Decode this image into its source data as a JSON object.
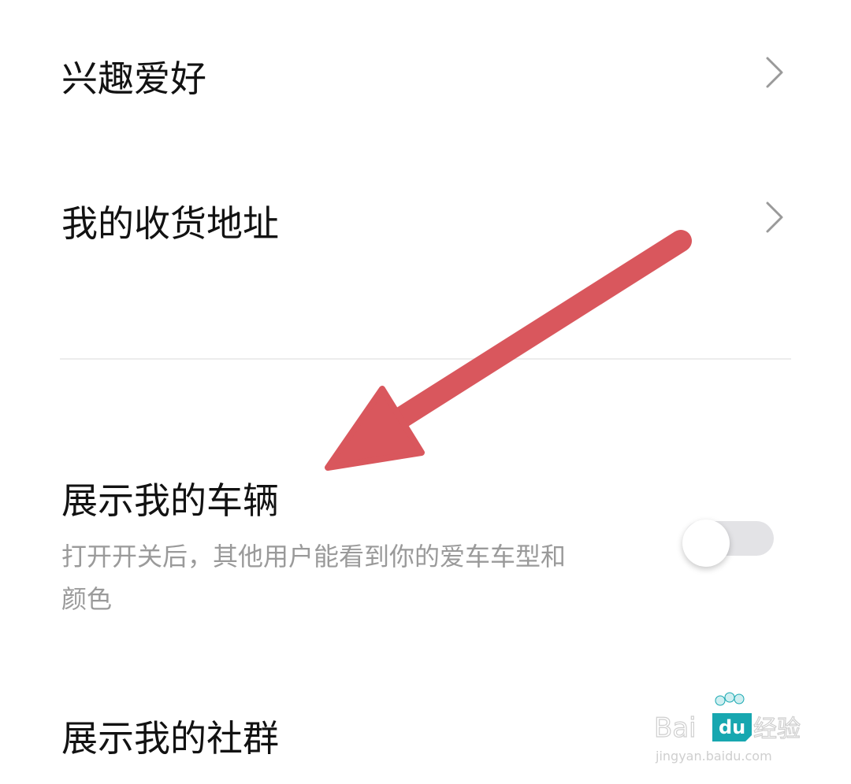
{
  "settings": {
    "items": [
      {
        "label": "兴趣爱好"
      },
      {
        "label": "我的收货地址"
      },
      {
        "label": "展示我的车辆",
        "description": "打开开关后，其他用户能看到你的爱车车型和颜色",
        "toggle_on": false
      },
      {
        "label": "展示我的社群"
      }
    ]
  },
  "watermark": {
    "brand": "Baidu",
    "cn": "经验",
    "url": "jingyan.baidu.com"
  },
  "colors": {
    "arrow": "#d9575d",
    "watermark": "#17a7b0",
    "toggle_track": "#e3e3e6"
  }
}
